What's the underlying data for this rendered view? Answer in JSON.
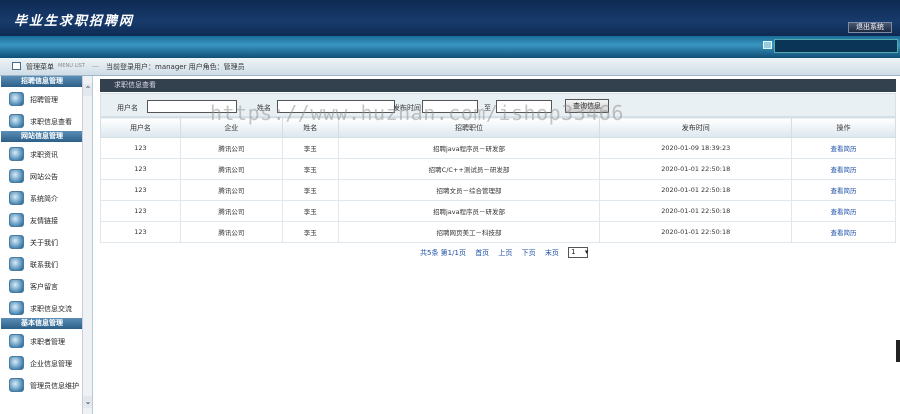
{
  "header": {
    "logo": "毕业生求职招聘网",
    "logout": "退出系统"
  },
  "breadcrumb": {
    "menu_label": "管理菜单",
    "menu_en": "MENU LIST",
    "separator": "—",
    "status": "当前登录用户：manager 用户角色：管理员"
  },
  "sidebar": {
    "groups": [
      {
        "title": "招聘信息管理",
        "items": [
          "招聘管理",
          "求职信息查看"
        ]
      },
      {
        "title": "网站信息管理",
        "items": [
          "求职资讯",
          "网站公告",
          "系统简介",
          "友情链接",
          "关于我们",
          "联系我们",
          "客户留言",
          "求职信息交流"
        ]
      },
      {
        "title": "基本信息管理",
        "items": [
          "求职者管理",
          "企业信息管理",
          "管理员信息维护"
        ]
      }
    ]
  },
  "panel": {
    "title": "求职信息查看"
  },
  "search": {
    "user_label": "用户名",
    "name_label": "姓名",
    "time_label": "发布时间",
    "to_label": "至",
    "button": "查询信息"
  },
  "table": {
    "headers": [
      "用户名",
      "企业",
      "姓名",
      "招聘职位",
      "发布时间",
      "操作"
    ],
    "rows": [
      [
        "123",
        "腾讯公司",
        "李玉",
        "招聘java程序员－研发部",
        "2020-01-09 18:39:23",
        "查看简历"
      ],
      [
        "123",
        "腾讯公司",
        "李玉",
        "招聘C/C++测试员－研发部",
        "2020-01-01 22:50:18",
        "查看简历"
      ],
      [
        "123",
        "腾讯公司",
        "李玉",
        "招聘文员－综合管理部",
        "2020-01-01 22:50:18",
        "查看简历"
      ],
      [
        "123",
        "腾讯公司",
        "李玉",
        "招聘java程序员－研发部",
        "2020-01-01 22:50:18",
        "查看简历"
      ],
      [
        "123",
        "腾讯公司",
        "李玉",
        "招聘网页美工－科技部",
        "2020-01-01 22:50:18",
        "查看简历"
      ]
    ]
  },
  "pager": {
    "summary": "共5条 第1/1页",
    "first": "首页",
    "prev": "上页",
    "next": "下页",
    "last": "末页",
    "page_select": "1"
  },
  "watermark": "https://www.huzhan.com/ishop33466"
}
